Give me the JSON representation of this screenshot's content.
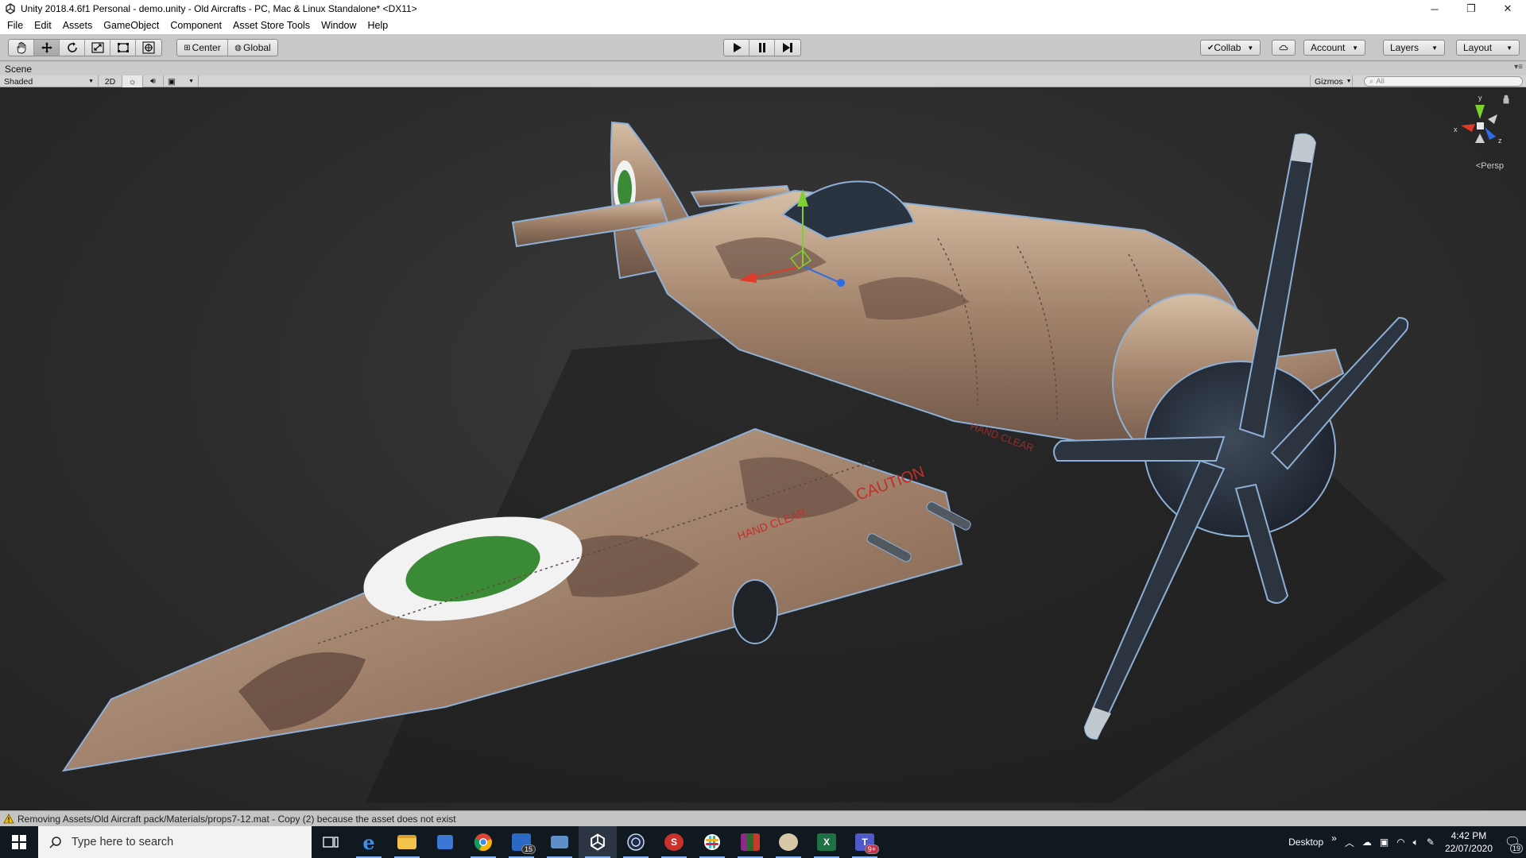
{
  "window": {
    "title": "Unity 2018.4.6f1 Personal - demo.unity - Old Aircrafts - PC, Mac & Linux Standalone* <DX11>",
    "minimize": "─",
    "restore": "❐",
    "close": "✕"
  },
  "menu": [
    "File",
    "Edit",
    "Assets",
    "GameObject",
    "Component",
    "Asset Store Tools",
    "Window",
    "Help"
  ],
  "toolbar": {
    "pivot_mode": "Center",
    "pivot_rotation": "Global",
    "collab": "Collab",
    "account": "Account",
    "layers": "Layers",
    "layout": "Layout"
  },
  "scene_tab": {
    "label": "Scene"
  },
  "scene_controls": {
    "draw_mode": "Shaded",
    "mode_2d": "2D",
    "gizmos": "Gizmos",
    "search_placeholder": "All"
  },
  "viewport": {
    "projection": "Persp",
    "gizmo_axes": {
      "x": "x",
      "y": "y",
      "z": "z"
    },
    "decals": [
      "CAUTION",
      "HAND CLEAR",
      "HAND CLEAR"
    ]
  },
  "status": {
    "message": "Removing Assets/Old Aircraft pack/Materials/props7-12.mat - Copy (2) because the asset does not exist"
  },
  "taskbar": {
    "search_placeholder": "Type here to search",
    "apps": [
      {
        "name": "task-view",
        "label": ""
      },
      {
        "name": "edge",
        "label": "e"
      },
      {
        "name": "file-explorer",
        "label": ""
      },
      {
        "name": "store",
        "label": ""
      },
      {
        "name": "chrome",
        "label": ""
      },
      {
        "name": "mail",
        "label": "",
        "badge": "15"
      },
      {
        "name": "pc",
        "label": ""
      },
      {
        "name": "unity",
        "label": ""
      },
      {
        "name": "cinema4d",
        "label": ""
      },
      {
        "name": "substance",
        "label": "S"
      },
      {
        "name": "slack",
        "label": ""
      },
      {
        "name": "winrar",
        "label": ""
      },
      {
        "name": "paint",
        "label": ""
      },
      {
        "name": "excel",
        "label": "X"
      },
      {
        "name": "teams",
        "label": "T",
        "badge": "9+"
      }
    ],
    "desktop_label": "Desktop",
    "chevron": "»",
    "time": "4:42 PM",
    "date": "22/07/2020",
    "notification_count": "19"
  },
  "colors": {
    "accent": "#8ab4f8",
    "roundel_green": "#3a8a36",
    "roundel_white": "#f2f2f2",
    "fuselage": "#a0826a",
    "camo_dark": "#5a4238",
    "propeller": "#2c3440",
    "gizmo_x": "#e23a2a",
    "gizmo_y": "#7dd12c",
    "gizmo_z": "#2e6be6"
  }
}
